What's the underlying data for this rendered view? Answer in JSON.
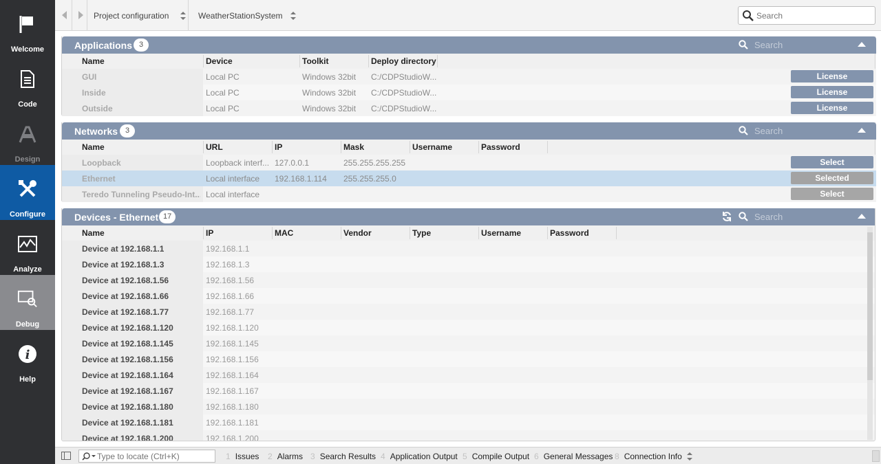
{
  "sidebar": {
    "items": [
      {
        "label": "Welcome",
        "icon": "flag-icon",
        "state": "normal"
      },
      {
        "label": "Code",
        "icon": "document-icon",
        "state": "normal"
      },
      {
        "label": "Design",
        "icon": "design-icon",
        "state": "disabled"
      },
      {
        "label": "Configure",
        "icon": "tools-icon",
        "state": "active"
      },
      {
        "label": "Analyze",
        "icon": "waveform-icon",
        "state": "normal"
      },
      {
        "label": "Debug",
        "icon": "debug-icon",
        "state": "highlight"
      },
      {
        "label": "Help",
        "icon": "info-icon",
        "state": "normal"
      }
    ]
  },
  "topbar": {
    "mode_combo": "Project configuration",
    "project_combo": "WeatherStationSystem",
    "search_placeholder": "Search"
  },
  "applications": {
    "title": "Applications",
    "count": "3",
    "search_placeholder": "Search",
    "columns": [
      "Name",
      "Device",
      "Toolkit",
      "Deploy directory"
    ],
    "rows": [
      {
        "name": "GUI",
        "device": "Local PC",
        "toolkit": "Windows 32bit",
        "dir": "C:/CDPStudioW...",
        "button": "License"
      },
      {
        "name": "Inside",
        "device": "Local PC",
        "toolkit": "Windows 32bit",
        "dir": "C:/CDPStudioW...",
        "button": "License"
      },
      {
        "name": "Outside",
        "device": "Local PC",
        "toolkit": "Windows 32bit",
        "dir": "C:/CDPStudioW...",
        "button": "License"
      }
    ]
  },
  "networks": {
    "title": "Networks",
    "count": "3",
    "search_placeholder": "Search",
    "columns": [
      "Name",
      "URL",
      "IP",
      "Mask",
      "Username",
      "Password"
    ],
    "rows": [
      {
        "name": "Loopback",
        "url": "Loopback interf...",
        "ip": "127.0.0.1",
        "mask": "255.255.255.255",
        "button": "Select",
        "selected": false
      },
      {
        "name": "Ethernet",
        "url": "Local interface",
        "ip": "192.168.1.114",
        "mask": "255.255.255.0",
        "button": "Selected",
        "selected": true
      },
      {
        "name": "Teredo Tunneling Pseudo-Int...",
        "url": "Local interface",
        "ip": "",
        "mask": "",
        "button": "Select",
        "selected": false
      }
    ]
  },
  "devices": {
    "title": "Devices - Ethernet",
    "count": "17",
    "search_placeholder": "Search",
    "columns": [
      "Name",
      "IP",
      "MAC",
      "Vendor",
      "Type",
      "Username",
      "Password"
    ],
    "rows": [
      {
        "name": "Device at 192.168.1.1",
        "ip": "192.168.1.1"
      },
      {
        "name": "Device at 192.168.1.3",
        "ip": "192.168.1.3"
      },
      {
        "name": "Device at 192.168.1.56",
        "ip": "192.168.1.56"
      },
      {
        "name": "Device at 192.168.1.66",
        "ip": "192.168.1.66"
      },
      {
        "name": "Device at 192.168.1.77",
        "ip": "192.168.1.77"
      },
      {
        "name": "Device at 192.168.1.120",
        "ip": "192.168.1.120"
      },
      {
        "name": "Device at 192.168.1.145",
        "ip": "192.168.1.145"
      },
      {
        "name": "Device at 192.168.1.156",
        "ip": "192.168.1.156"
      },
      {
        "name": "Device at 192.168.1.164",
        "ip": "192.168.1.164"
      },
      {
        "name": "Device at 192.168.1.167",
        "ip": "192.168.1.167"
      },
      {
        "name": "Device at 192.168.1.180",
        "ip": "192.168.1.180"
      },
      {
        "name": "Device at 192.168.1.181",
        "ip": "192.168.1.181"
      },
      {
        "name": "Device at 192.168.1.200",
        "ip": "192.168.1.200"
      }
    ]
  },
  "bottombar": {
    "locate_placeholder": "Type to locate (Ctrl+K)",
    "tabs": [
      {
        "num": "1",
        "label": "Issues"
      },
      {
        "num": "2",
        "label": "Alarms"
      },
      {
        "num": "3",
        "label": "Search Results"
      },
      {
        "num": "4",
        "label": "Application Output"
      },
      {
        "num": "5",
        "label": "Compile Output"
      },
      {
        "num": "6",
        "label": "General Messages"
      },
      {
        "num": "8",
        "label": "Connection Info"
      }
    ]
  },
  "colors": {
    "sidebar_bg": "#2f3033",
    "active_bg": "#0f5ba4",
    "panel_header": "#8394ad",
    "selected_row": "#c7dcee"
  }
}
